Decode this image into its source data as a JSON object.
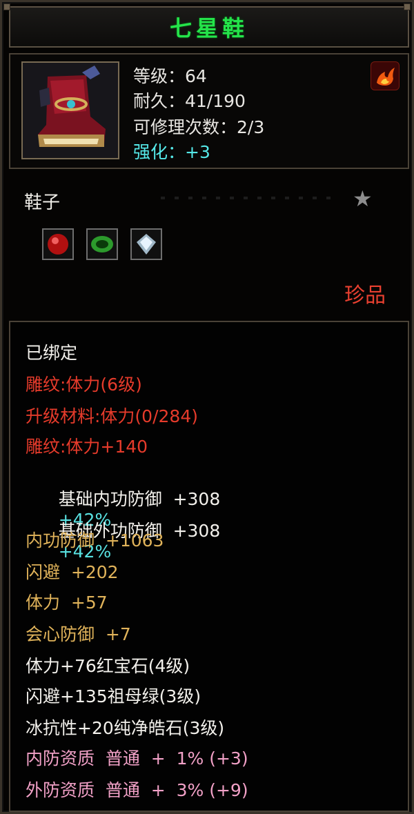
{
  "item": {
    "name": "七星鞋",
    "level": "等级：64",
    "durability": "耐久：41/190",
    "repair_count": "可修理次数：2/3",
    "enhance": "强化：+3",
    "type": "鞋子",
    "rarity": "珍品"
  },
  "gems": [
    "ruby-gem-icon",
    "emerald-gem-icon",
    "pure-diamond-gem-icon"
  ],
  "details": [
    {
      "text": "已绑定",
      "color": "white"
    },
    {
      "text": "雕纹:体力(6级)",
      "color": "red"
    },
    {
      "text": "升级材料:体力(0/284)",
      "color": "red"
    },
    {
      "text": "雕纹:体力+140",
      "color": "red"
    },
    {
      "text": "基础内功防御  +308",
      "extra": "+42%",
      "color": "white"
    },
    {
      "text": "基础外功防御  +308",
      "extra": "+42%",
      "color": "white"
    },
    {
      "text": "内功防御  +1063",
      "color": "gold"
    },
    {
      "text": "闪避  +202",
      "color": "gold"
    },
    {
      "text": "体力  +57",
      "color": "gold"
    },
    {
      "text": "会心防御  +7",
      "color": "gold"
    },
    {
      "text": "体力+76红宝石(4级)",
      "color": "white"
    },
    {
      "text": "闪避+135祖母绿(3级)",
      "color": "white"
    },
    {
      "text": "冰抗性+20纯净皓石(3级)",
      "color": "white"
    },
    {
      "text": "内防资质  普通  +  1% (+3)",
      "color": "pink"
    },
    {
      "text": "外防资质  普通  +  3% (+9)",
      "color": "pink"
    }
  ],
  "colors": {
    "title": "#24e44a",
    "enhance": "#55e8e8",
    "rarity": "#e84030",
    "red": "#e63b2b",
    "gold": "#e0b35a",
    "pink": "#f2a1c7",
    "cyan": "#59e2e2"
  }
}
